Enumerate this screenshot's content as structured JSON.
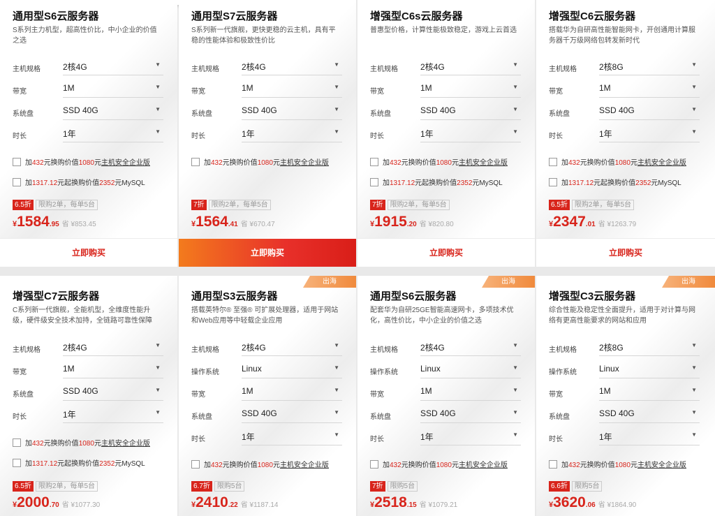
{
  "labels": {
    "spec": "主机规格",
    "bandwidth": "带宽",
    "disk": "系统盘",
    "duration": "时长",
    "os": "操作系统",
    "buy": "立即购买",
    "badge": "出海",
    "currency": "¥",
    "save_prefix": "省",
    "addon1": {
      "p1": "加",
      "p2": "432",
      "p3": "元换购价值",
      "p4": "1080",
      "p5": "元",
      "p6": "主机安全企业版"
    },
    "addon2": {
      "p1": "加",
      "p2": "1317.12",
      "p3": "元起换购价值",
      "p4": "2352",
      "p5": "元MySQL"
    }
  },
  "cards": [
    {
      "title": "通用型S6云服务器",
      "desc": "S系列主力机型，超高性价比，中小企业的价值之选",
      "spec": "2核4G",
      "bandwidth": "1M",
      "disk": "SSD 40G",
      "duration": "1年",
      "discount": "6.5折",
      "limit": "限购2单，每单5台",
      "price_int": "1584",
      "price_dec": ".95",
      "save": "¥853.45"
    },
    {
      "title": "通用型S7云服务器",
      "desc": "S系列新一代旗舰，更快更稳的云主机，具有平稳的性能体验和极致性价比",
      "spec": "2核4G",
      "bandwidth": "1M",
      "disk": "SSD 40G",
      "duration": "1年",
      "discount": "7折",
      "limit": "限购2单，每单5台",
      "price_int": "1564",
      "price_dec": ".41",
      "save": "¥670.47"
    },
    {
      "title": "增强型C6s云服务器",
      "desc": "普惠型价格，计算性能极致稳定，游戏上云首选",
      "spec": "2核4G",
      "bandwidth": "1M",
      "disk": "SSD 40G",
      "duration": "1年",
      "discount": "7折",
      "limit": "限购2单，每单5台",
      "price_int": "1915",
      "price_dec": ".20",
      "save": "¥820.80"
    },
    {
      "title": "增强型C6云服务器",
      "desc": "搭载华为自研高性能智能网卡，开创通用计算服务器千万级网络包转发新时代",
      "spec": "2核8G",
      "bandwidth": "1M",
      "disk": "SSD 40G",
      "duration": "1年",
      "discount": "6.5折",
      "limit": "限购2单，每单5台",
      "price_int": "2347",
      "price_dec": ".01",
      "save": "¥1263.79"
    },
    {
      "title": "增强型C7云服务器",
      "desc": "C系列新一代旗舰，全能机型，全维度性能升级，硬件级安全技术加持，全链路可靠性保障",
      "spec": "2核4G",
      "bandwidth": "1M",
      "disk": "SSD 40G",
      "duration": "1年",
      "discount": "6.5折",
      "limit": "限购2单，每单5台",
      "price_int": "2000",
      "price_dec": ".70",
      "save": "¥1077.30"
    },
    {
      "title": "通用型S3云服务器",
      "desc": "搭载英特尔® 至强® 可扩展处理器，适用于网站和Web应用等中轻载企业应用",
      "spec": "2核4G",
      "os": "Linux",
      "bandwidth": "1M",
      "disk": "SSD 40G",
      "duration": "1年",
      "discount": "6.7折",
      "limit": "限购5台",
      "price_int": "2410",
      "price_dec": ".22",
      "save": "¥1187.14"
    },
    {
      "title": "通用型S6云服务器",
      "desc": "配套华为自研25GE智能高速网卡，多项技术优化，高性价比，中小企业的价值之选",
      "spec": "2核4G",
      "os": "Linux",
      "bandwidth": "1M",
      "disk": "SSD 40G",
      "duration": "1年",
      "discount": "7折",
      "limit": "限购5台",
      "price_int": "2518",
      "price_dec": ".15",
      "save": "¥1079.21"
    },
    {
      "title": "增强型C3云服务器",
      "desc": "综合性能及稳定性全面提升，适用于对计算与网络有更高性能要求的网站和应用",
      "spec": "2核8G",
      "os": "Linux",
      "bandwidth": "1M",
      "disk": "SSD 40G",
      "duration": "1年",
      "discount": "6.6折",
      "limit": "限购5台",
      "price_int": "3620",
      "price_dec": ".06",
      "save": "¥1864.90"
    }
  ],
  "colors": {
    "accent": "#d8241b",
    "badge": "#f08a3c",
    "buy_active_start": "#f37b1d",
    "buy_active_end": "#d91e18"
  }
}
